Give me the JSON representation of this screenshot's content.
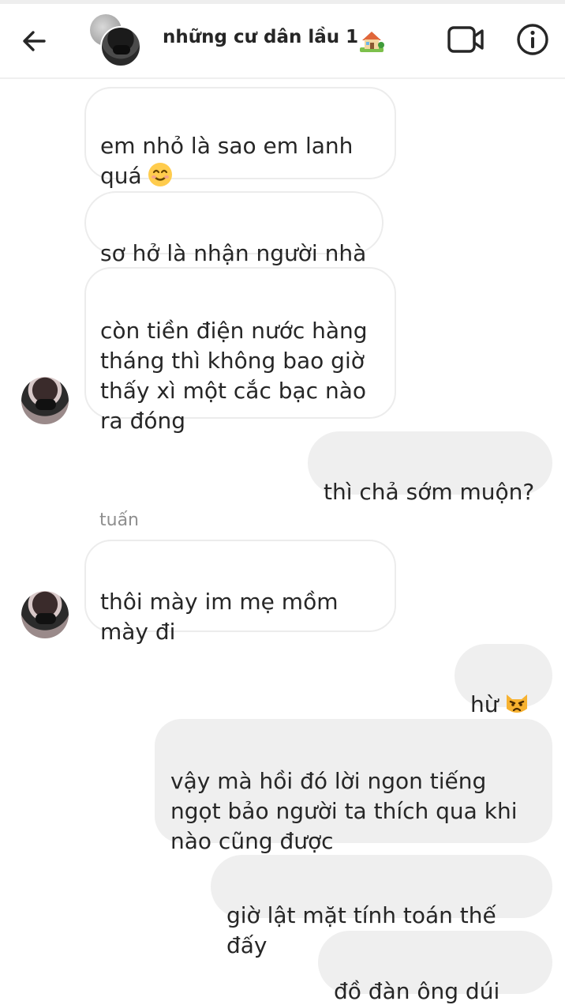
{
  "header": {
    "title": "những cư dân lầu 1",
    "title_emoji": "house-with-garden-icon",
    "back_icon": "arrow-left-icon",
    "video_icon": "video-camera-icon",
    "info_icon": "info-icon"
  },
  "messages": [
    {
      "direction": "incoming",
      "text": "em nhỏ là sao em lanh\nquá",
      "emoji": "smiling-face-icon"
    },
    {
      "direction": "incoming",
      "text": "sơ hở là nhận người nhà"
    },
    {
      "direction": "incoming",
      "text": "còn tiền điện nước hàng\ntháng thì không bao giờ\nthấy xì một cắc bạc nào\nra đóng"
    },
    {
      "direction": "outgoing",
      "text": "thì chả sớm muộn?"
    },
    {
      "direction": "incoming",
      "sender": "tuấn",
      "text": "thôi mày im mẹ mồm\nmày đi"
    },
    {
      "direction": "outgoing",
      "text": "hừ",
      "emoji": "pouting-cat-icon"
    },
    {
      "direction": "outgoing",
      "text": "vậy mà hồi đó lời ngon tiếng\nngọt bảo người ta thích qua khi\nnào cũng được"
    },
    {
      "direction": "outgoing",
      "text": "giờ lật mặt tính toán thế đấy"
    },
    {
      "direction": "outgoing",
      "text": "đồ đàn ông dúi trá"
    }
  ],
  "colors": {
    "outgoing_bubble": "#efefef",
    "incoming_border": "#ececec",
    "text": "#262626",
    "sender": "#8e8e8e"
  }
}
